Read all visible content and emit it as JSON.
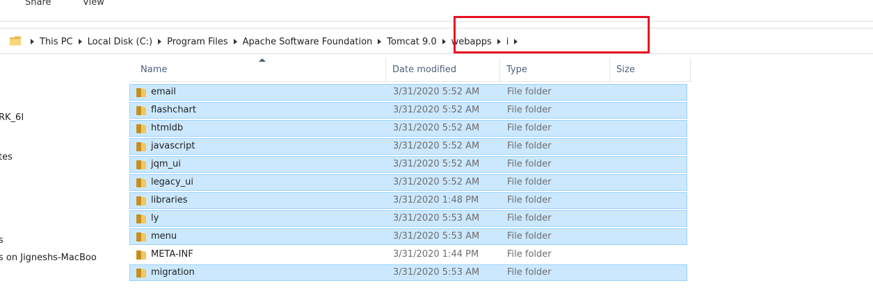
{
  "ribbon": {
    "tabs": [
      "Share",
      "View"
    ]
  },
  "address_bar": {
    "breadcrumbs": [
      "This PC",
      "Local Disk (C:)",
      "Program Files",
      "Apache Software Foundation",
      "Tomcat 9.0",
      "webapps",
      "i"
    ],
    "highlight_color": "#e81123"
  },
  "nav_pane": {
    "items": [
      "RK_6I",
      "tes",
      "s",
      "s on Jigneshs-MacBoo"
    ]
  },
  "file_list": {
    "columns": [
      "Name",
      "Date modified",
      "Type",
      "Size"
    ],
    "sorted_by": "Name",
    "selection_color": "#cce8ff",
    "rows": [
      {
        "name": "email",
        "date": "3/31/2020 5:52 AM",
        "type": "File folder",
        "selected": true
      },
      {
        "name": "flashchart",
        "date": "3/31/2020 5:52 AM",
        "type": "File folder",
        "selected": true
      },
      {
        "name": "htmldb",
        "date": "3/31/2020 5:52 AM",
        "type": "File folder",
        "selected": true
      },
      {
        "name": "javascript",
        "date": "3/31/2020 5:52 AM",
        "type": "File folder",
        "selected": true
      },
      {
        "name": "jqm_ui",
        "date": "3/31/2020 5:52 AM",
        "type": "File folder",
        "selected": true
      },
      {
        "name": "legacy_ui",
        "date": "3/31/2020 5:52 AM",
        "type": "File folder",
        "selected": true
      },
      {
        "name": "libraries",
        "date": "3/31/2020 1:48 PM",
        "type": "File folder",
        "selected": true
      },
      {
        "name": "ly",
        "date": "3/31/2020 5:53 AM",
        "type": "File folder",
        "selected": true
      },
      {
        "name": "menu",
        "date": "3/31/2020 5:53 AM",
        "type": "File folder",
        "selected": true
      },
      {
        "name": "META-INF",
        "date": "3/31/2020 1:44 PM",
        "type": "File folder",
        "selected": false
      },
      {
        "name": "migration",
        "date": "3/31/2020 5:53 AM",
        "type": "File folder",
        "selected": true
      }
    ]
  }
}
